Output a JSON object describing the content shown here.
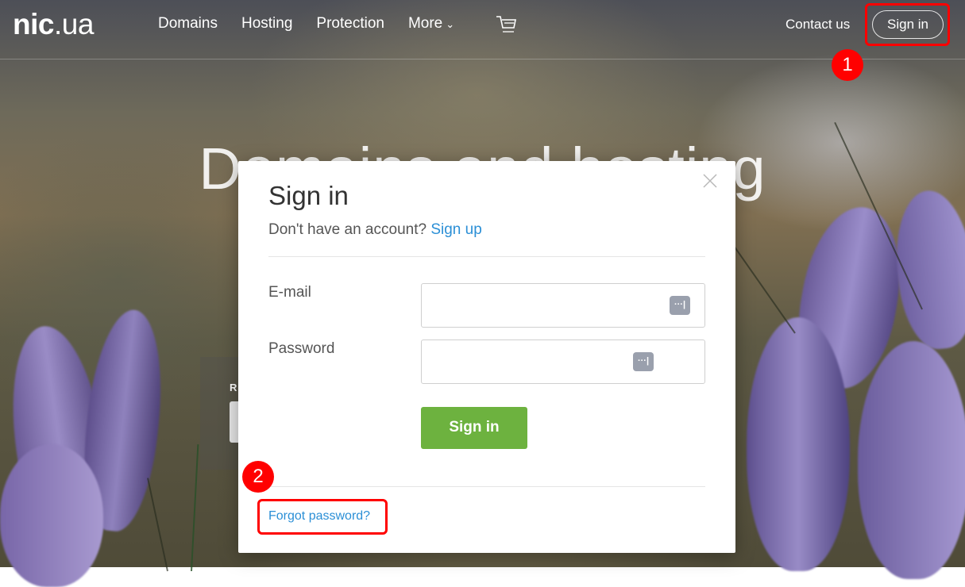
{
  "header": {
    "logo_bold": "nic",
    "logo_rest": ".ua",
    "nav": [
      "Domains",
      "Hosting",
      "Protection",
      "More"
    ],
    "contact": "Contact us",
    "sign_in": "Sign in"
  },
  "hero": {
    "title": "Domains and hosting",
    "ghost_letter": "R"
  },
  "modal": {
    "title": "Sign in",
    "subtitle": "Don't have an account?",
    "signup_link": "Sign up",
    "email_label": "E-mail",
    "password_label": "Password",
    "dots": "···|",
    "submit": "Sign in",
    "forgot": "Forgot password?"
  },
  "annotations": {
    "step1": "1",
    "step2": "2",
    "highlight_color": "#ff0000"
  },
  "colors": {
    "link": "#2b8fd6",
    "button": "#6db23f"
  }
}
